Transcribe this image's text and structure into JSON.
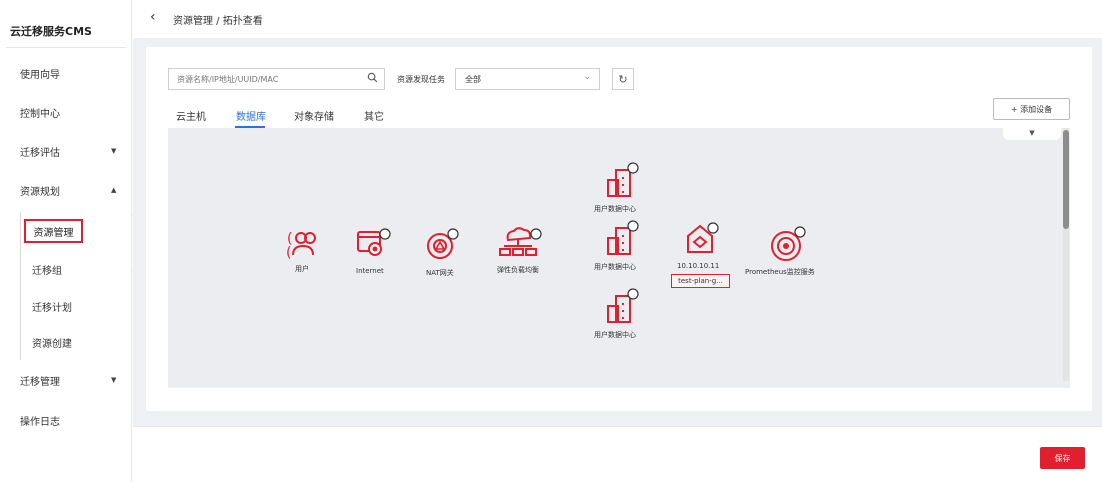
{
  "app": {
    "brand": "云迁移服务CMS"
  },
  "sidebar": {
    "items": [
      {
        "label": "使用向导"
      },
      {
        "label": "控制中心"
      },
      {
        "label": "迁移评估"
      },
      {
        "label": "资源规划"
      },
      {
        "label": "迁移管理"
      },
      {
        "label": "操作日志"
      }
    ],
    "sub_items": [
      {
        "label": "资源管理",
        "active": true
      },
      {
        "label": "迁移组"
      },
      {
        "label": "迁移计划"
      },
      {
        "label": "资源创建"
      }
    ]
  },
  "header": {
    "back_icon": "chevron-left-icon",
    "breadcrumb": "资源管理 / 拓扑查看"
  },
  "toolbar": {
    "search_placeholder": "资源名称/IP地址/UUID/MAC",
    "task_label": "资源发现任务",
    "task_value": "全部",
    "add_device": "+ 添加设备"
  },
  "tabs": [
    {
      "label": "云主机"
    },
    {
      "label": "数据库",
      "active": true
    },
    {
      "label": "对象存储"
    },
    {
      "label": "其它"
    }
  ],
  "topology": {
    "nodes": [
      {
        "label": "用户",
        "icon": "users-icon"
      },
      {
        "label": "Internet",
        "icon": "internet-icon"
      },
      {
        "label": "NAT网关",
        "icon": "nat-gateway-icon"
      },
      {
        "label": "弹性负载均衡",
        "icon": "load-balancer-icon"
      },
      {
        "label": "用户数据中心",
        "icon": "datacenter-icon"
      },
      {
        "label": "用户数据中心",
        "icon": "datacenter-icon"
      },
      {
        "label": "用户数据中心",
        "icon": "datacenter-icon"
      },
      {
        "label": "10.10.10.11",
        "tag": "test-plan-g...",
        "icon": "server-icon"
      },
      {
        "label": "Prometheus监控服务",
        "icon": "monitor-icon"
      }
    ]
  },
  "footer": {
    "save_label": "保存"
  },
  "colors": {
    "accent": "#e0202f",
    "tab_active": "#2f6fe4",
    "canvas_bg": "#ebedf0"
  }
}
